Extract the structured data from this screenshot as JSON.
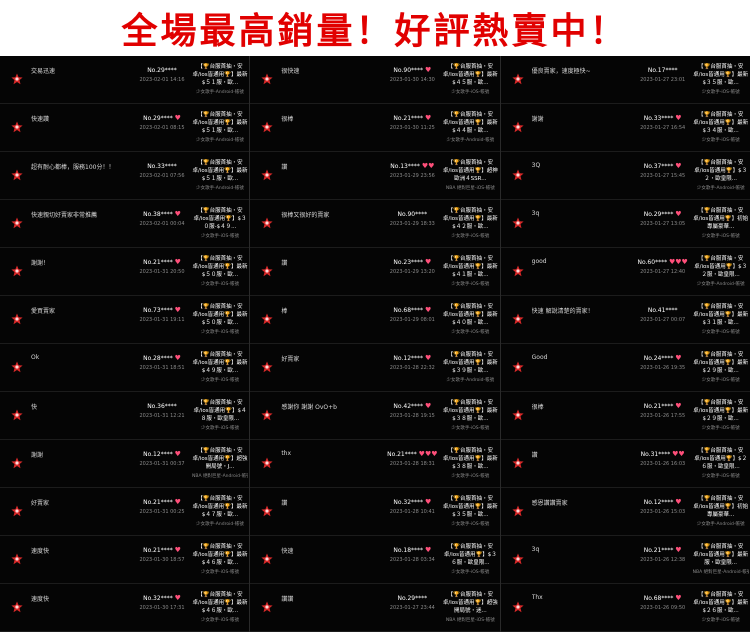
{
  "banner": {
    "title": "全場最高銷量！好評熱賣中！"
  },
  "colors": {
    "background": "#050505",
    "banner_text": "#e10000",
    "heart": "#ff4f7a",
    "marker": "#d82828"
  },
  "icons": {
    "row_marker": "red-star-badge-icon",
    "buyer_heart": "heart-icon"
  },
  "columns": [
    {
      "rows": [
        {
          "comment": "交易迅速",
          "buyer": "No.29****",
          "hearts": "",
          "date": "2023-02-01 14:16",
          "product": "【🏆台服首抽・安卓/ios皆通用🏆】最新$５１服・歐...",
          "category": "少女歌手-Android-帳號"
        },
        {
          "comment": "快速讚",
          "buyer": "No.29****",
          "hearts": "♥",
          "date": "2023-02-01 08:15",
          "product": "【🏆台服首抽・安卓/ios皆通用🏆】最新$５１服・歐...",
          "category": "少女歌手-Android-帳號"
        },
        {
          "comment": "超有耐心都棒，服務100分！！",
          "buyer": "No.33****",
          "hearts": "",
          "date": "2023-02-01 07:56",
          "product": "【🏆台服首抽・安卓/ios皆通用🏆】最新$５１服・歐...",
          "category": "少女歌手-Android-帳號"
        },
        {
          "comment": "快速親切好賣家非常推薦",
          "buyer": "No.38****",
          "hearts": "♥",
          "date": "2023-02-01 00:04",
          "product": "【🏆台服首抽・安卓/ios皆通用🏆】$３０服-$４９...",
          "category": "少女歌手-iOS-帳號"
        },
        {
          "comment": "謝謝！",
          "buyer": "No.21****",
          "hearts": "♥",
          "date": "2023-01-31 20:50",
          "product": "【🏆台服首抽・安卓/ios皆通用🏆】最新$５０服・歐...",
          "category": "少女歌手-iOS-帳號"
        },
        {
          "comment": "愛買賣家",
          "buyer": "No.73****",
          "hearts": "♥",
          "date": "2023-01-31 19:11",
          "product": "【🏆台服首抽・安卓/ios皆通用🏆】最新$５０服・歐...",
          "category": "少女歌手-iOS-帳號"
        },
        {
          "comment": "Ok",
          "buyer": "No.28****",
          "hearts": "♥",
          "date": "2023-01-31 18:51",
          "product": "【🏆台服首抽・安卓/ios皆通用🏆】最新$４９服・歐...",
          "category": "少女歌手-iOS-帳號"
        },
        {
          "comment": "快",
          "buyer": "No.36****",
          "hearts": "",
          "date": "2023-01-31 12:21",
          "product": "【🏆台服首抽・安卓/ios皆通用🏆】$４８服・歐皇限...",
          "category": "少女歌手-iOS-帳號"
        },
        {
          "comment": "謝謝",
          "buyer": "No.12****",
          "hearts": "♥",
          "date": "2023-01-31 00:37",
          "product": "【🏆台服首抽・安卓/ios皆通用🏆】超強開局號・J...",
          "category": "NBA 絕對巨星-Android-帳號"
        },
        {
          "comment": "好賣家",
          "buyer": "No.21****",
          "hearts": "♥",
          "date": "2023-01-31 00:25",
          "product": "【🏆台服首抽・安卓/ios皆通用🏆】最新$４７服・歐...",
          "category": "少女歌手-Android-帳號"
        },
        {
          "comment": "速度快",
          "buyer": "No.21****",
          "hearts": "♥",
          "date": "2023-01-30 18:57",
          "product": "【🏆台服首抽・安卓/ios皆通用🏆】最新$４６服・歐...",
          "category": "少女歌手-iOS-帳號"
        },
        {
          "comment": "速度快",
          "buyer": "No.32****",
          "hearts": "♥",
          "date": "2023-01-30 17:31",
          "product": "【🏆台服首抽・安卓/ios皆通用🏆】最新$４６服・歐...",
          "category": "少女歌手-iOS-帳號"
        }
      ]
    },
    {
      "rows": [
        {
          "comment": "很快速",
          "buyer": "No.90****",
          "hearts": "♥",
          "date": "2023-01-30 14:30",
          "product": "【🏆台服首抽・安卓/ios皆通用🏆】最新$４５服・歐...",
          "category": "少女歌手-iOS-帳號"
        },
        {
          "comment": "很棒",
          "buyer": "No.21****",
          "hearts": "♥",
          "date": "2023-01-30 11:25",
          "product": "【🏆台服首抽・安卓/ios皆通用🏆】最新$４４服・歐...",
          "category": "少女歌手-Android-帳號"
        },
        {
          "comment": "讚",
          "buyer": "No.13****",
          "hearts": "♥♥",
          "date": "2023-01-29 23:56",
          "product": "【🏆台服首抽・安卓/ios皆通用🏆】超神歐洲４SSR...",
          "category": "NBA 絕對巨星-iOS-帳號"
        },
        {
          "comment": "很棒又很好的賣家",
          "buyer": "No.90****",
          "hearts": "",
          "date": "2023-01-29 18:33",
          "product": "【🏆台服首抽・安卓/ios皆通用🏆】最新$４２服・歐...",
          "category": "少女歌手-iOS-帳號"
        },
        {
          "comment": "讚",
          "buyer": "No.23****",
          "hearts": "♥",
          "date": "2023-01-29 13:20",
          "product": "【🏆台服首抽・安卓/ios皆通用🏆】最新$４１服・歐...",
          "category": "少女歌手-iOS-帳號"
        },
        {
          "comment": "棒",
          "buyer": "No.68****",
          "hearts": "♥",
          "date": "2023-01-29 08:01",
          "product": "【🏆台服首抽・安卓/ios皆通用🏆】最新$４０服・歐...",
          "category": "少女歌手-iOS-帳號"
        },
        {
          "comment": "好賣家",
          "buyer": "No.12****",
          "hearts": "♥",
          "date": "2023-01-28 22:32",
          "product": "【🏆台服首抽・安卓/ios皆通用🏆】最新$３９服・歐...",
          "category": "少女歌手-Android-帳號"
        },
        {
          "comment": "感謝你 謝謝 OvO+b",
          "buyer": "No.42****",
          "hearts": "♥",
          "date": "2023-01-28 19:15",
          "product": "【🏆台服首抽・安卓/ios皆通用🏆】最新$３８服・歐...",
          "category": "少女歌手-iOS-帳號"
        },
        {
          "comment": "thx",
          "buyer": "No.21****",
          "hearts": "♥♥♥",
          "date": "2023-01-28 18:31",
          "product": "【🏆台服首抽・安卓/ios皆通用🏆】最新$３８服・歐...",
          "category": "少女歌手-iOS-帳號"
        },
        {
          "comment": "讚",
          "buyer": "No.32****",
          "hearts": "♥",
          "date": "2023-01-28 10:41",
          "product": "【🏆台服首抽・安卓/ios皆通用🏆】最新$３５服・歐...",
          "category": "少女歌手-iOS-帳號"
        },
        {
          "comment": "快速",
          "buyer": "No.18****",
          "hearts": "♥",
          "date": "2023-01-28 03:34",
          "product": "【🏆台服首抽・安卓/ios皆通用🏆】$３６服・歐皇限...",
          "category": "少女歌手-iOS-帳號"
        },
        {
          "comment": "讚讚",
          "buyer": "No.29****",
          "hearts": "",
          "date": "2023-01-27 23:44",
          "product": "【🏆台服首抽・安卓/ios皆通用🏆】超強開局號・迷...",
          "category": "NBA 絕對巨星-iOS-帳號"
        }
      ]
    },
    {
      "rows": [
        {
          "comment": "優良賣家，速度極快~",
          "buyer": "No.17****",
          "hearts": "",
          "date": "2023-01-27 23:01",
          "product": "【🏆台服首抽・安卓/ios皆通用🏆】最新$３５服・歐...",
          "category": "少女歌手-iOS-帳號"
        },
        {
          "comment": "謝謝",
          "buyer": "No.33****",
          "hearts": "♥",
          "date": "2023-01-27 16:54",
          "product": "【🏆台服首抽・安卓/ios皆通用🏆】最新$３４服・歐...",
          "category": "少女歌手-iOS-帳號"
        },
        {
          "comment": "3Q",
          "buyer": "No.37****",
          "hearts": "♥",
          "date": "2023-01-27 15:45",
          "product": "【🏆台服首抽・安卓/ios皆通用🏆】$３２・歐皇限...",
          "category": "少女歌手-Android-帳號"
        },
        {
          "comment": "3q",
          "buyer": "No.29****",
          "hearts": "♥",
          "date": "2023-01-27 13:05",
          "product": "【🏆台服首抽・安卓/ios皆通用🏆】初始專屬豪華...",
          "category": "少女歌手-iOS-帳號"
        },
        {
          "comment": "good",
          "buyer": "No.60****",
          "hearts": "♥♥♥",
          "date": "2023-01-27 12:40",
          "product": "【🏆台服首抽・安卓/ios皆通用🏆】$３２服・歐皇限...",
          "category": "少女歌手-Android-帳號"
        },
        {
          "comment": "快速 解說清楚的賣家！",
          "buyer": "No.41****",
          "hearts": "",
          "date": "2023-01-27 00:07",
          "product": "【🏆台服首抽・安卓/ios皆通用🏆】最新$３１服・歐...",
          "category": "少女歌手-iOS-帳號"
        },
        {
          "comment": "Good",
          "buyer": "No.24****",
          "hearts": "♥",
          "date": "2023-01-26 19:35",
          "product": "【🏆台服首抽・安卓/ios皆通用🏆】最新$２９服・歐...",
          "category": "少女歌手-iOS-帳號"
        },
        {
          "comment": "很棒",
          "buyer": "No.21****",
          "hearts": "♥",
          "date": "2023-01-26 17:55",
          "product": "【🏆台服首抽・安卓/ios皆通用🏆】最新$２９服・歐...",
          "category": "少女歌手-iOS-帳號"
        },
        {
          "comment": "讚",
          "buyer": "No.31****",
          "hearts": "♥♥",
          "date": "2023-01-26 16:03",
          "product": "【🏆台服首抽・安卓/ios皆通用🏆】$２６服・歐皇限...",
          "category": "少女歌手-iOS-帳號"
        },
        {
          "comment": "感恩讚讚賣家",
          "buyer": "No.12****",
          "hearts": "♥",
          "date": "2023-01-26 15:03",
          "product": "【🏆台服首抽・安卓/ios皆通用🏆】初始專屬豪華...",
          "category": "少女歌手-Android-帳號"
        },
        {
          "comment": "3q",
          "buyer": "No.21****",
          "hearts": "♥",
          "date": "2023-01-26 12:38",
          "product": "【🏆台服首抽・安卓/ios皆通用🏆】最新服・歐皇限...",
          "category": "NBA 絕對巨星-Android-帳號"
        },
        {
          "comment": "Thx",
          "buyer": "No.68****",
          "hearts": "♥",
          "date": "2023-01-26 09:50",
          "product": "【🏆台服首抽・安卓/ios皆通用🏆】最新$２６服・歐...",
          "category": "少女歌手-iOS-帳號"
        }
      ]
    }
  ]
}
